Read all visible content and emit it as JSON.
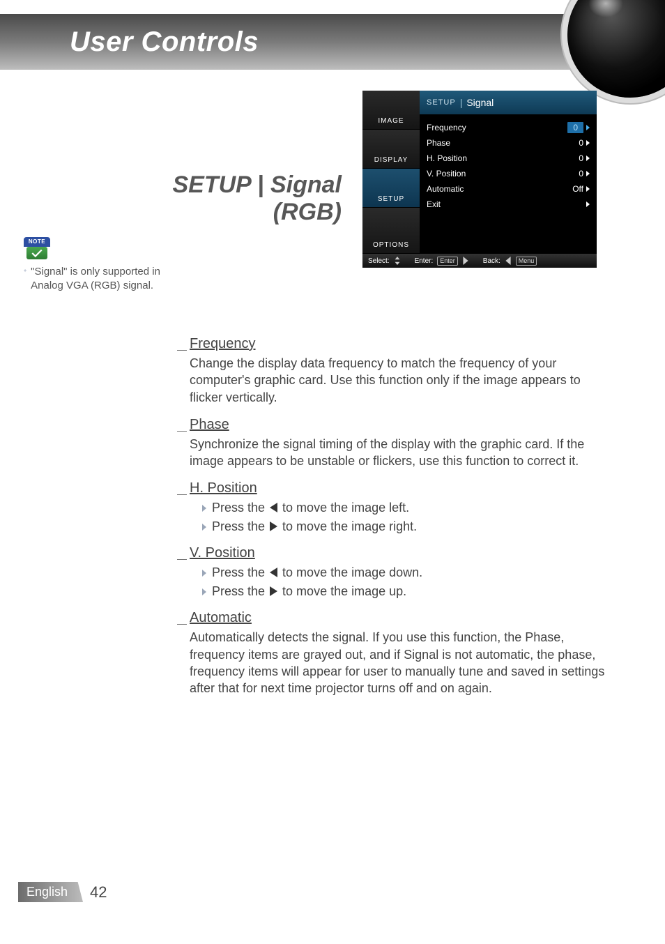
{
  "header": {
    "title": "User Controls"
  },
  "section_title_line1": "SETUP | Signal",
  "section_title_line2": "(RGB)",
  "note": {
    "badge_label": "NOTE",
    "text": "\"Signal\" is only supported in Analog VGA (RGB) signal."
  },
  "osd": {
    "tabs": [
      "IMAGE",
      "DISPLAY",
      "SETUP",
      "OPTIONS"
    ],
    "active_tab_index": 2,
    "breadcrumb_parent": "SETUP",
    "breadcrumb_current": "Signal",
    "rows": [
      {
        "label": "Frequency",
        "value": "0",
        "selected": true
      },
      {
        "label": "Phase",
        "value": "0"
      },
      {
        "label": "H. Position",
        "value": "0"
      },
      {
        "label": "V. Position",
        "value": "0"
      },
      {
        "label": "Automatic",
        "value": "Off"
      },
      {
        "label": "Exit",
        "value": ""
      }
    ],
    "footer": {
      "select_label": "Select:",
      "enter_label": "Enter:",
      "enter_key": "Enter",
      "back_label": "Back:",
      "back_key": "Menu"
    }
  },
  "items": {
    "frequency": {
      "heading": "Frequency",
      "body": "Change the display data frequency to match the frequency of your computer's graphic card. Use this function only if the image appears to flicker vertically."
    },
    "phase": {
      "heading": "Phase",
      "body": "Synchronize the signal timing of the display with the graphic card. If the image appears to be unstable or flickers, use this function to correct it."
    },
    "hpos": {
      "heading": "H. Position",
      "bullets": [
        {
          "pre": "Press the ",
          "dir": "left",
          "post": " to move the image left."
        },
        {
          "pre": "Press the ",
          "dir": "right",
          "post": " to move the image right."
        }
      ]
    },
    "vpos": {
      "heading": "V. Position",
      "bullets": [
        {
          "pre": "Press the ",
          "dir": "left",
          "post": " to move the image down."
        },
        {
          "pre": "Press the ",
          "dir": "right",
          "post": " to move the image up."
        }
      ]
    },
    "automatic": {
      "heading": "Automatic",
      "body": "Automatically detects the signal. If you use this function, the Phase, frequency items are grayed out, and if Signal is not automatic, the phase, frequency items will appear for user to manually tune and saved in settings after that for next time projector turns off and on again."
    }
  },
  "footer": {
    "language": "English",
    "page_number": "42"
  }
}
